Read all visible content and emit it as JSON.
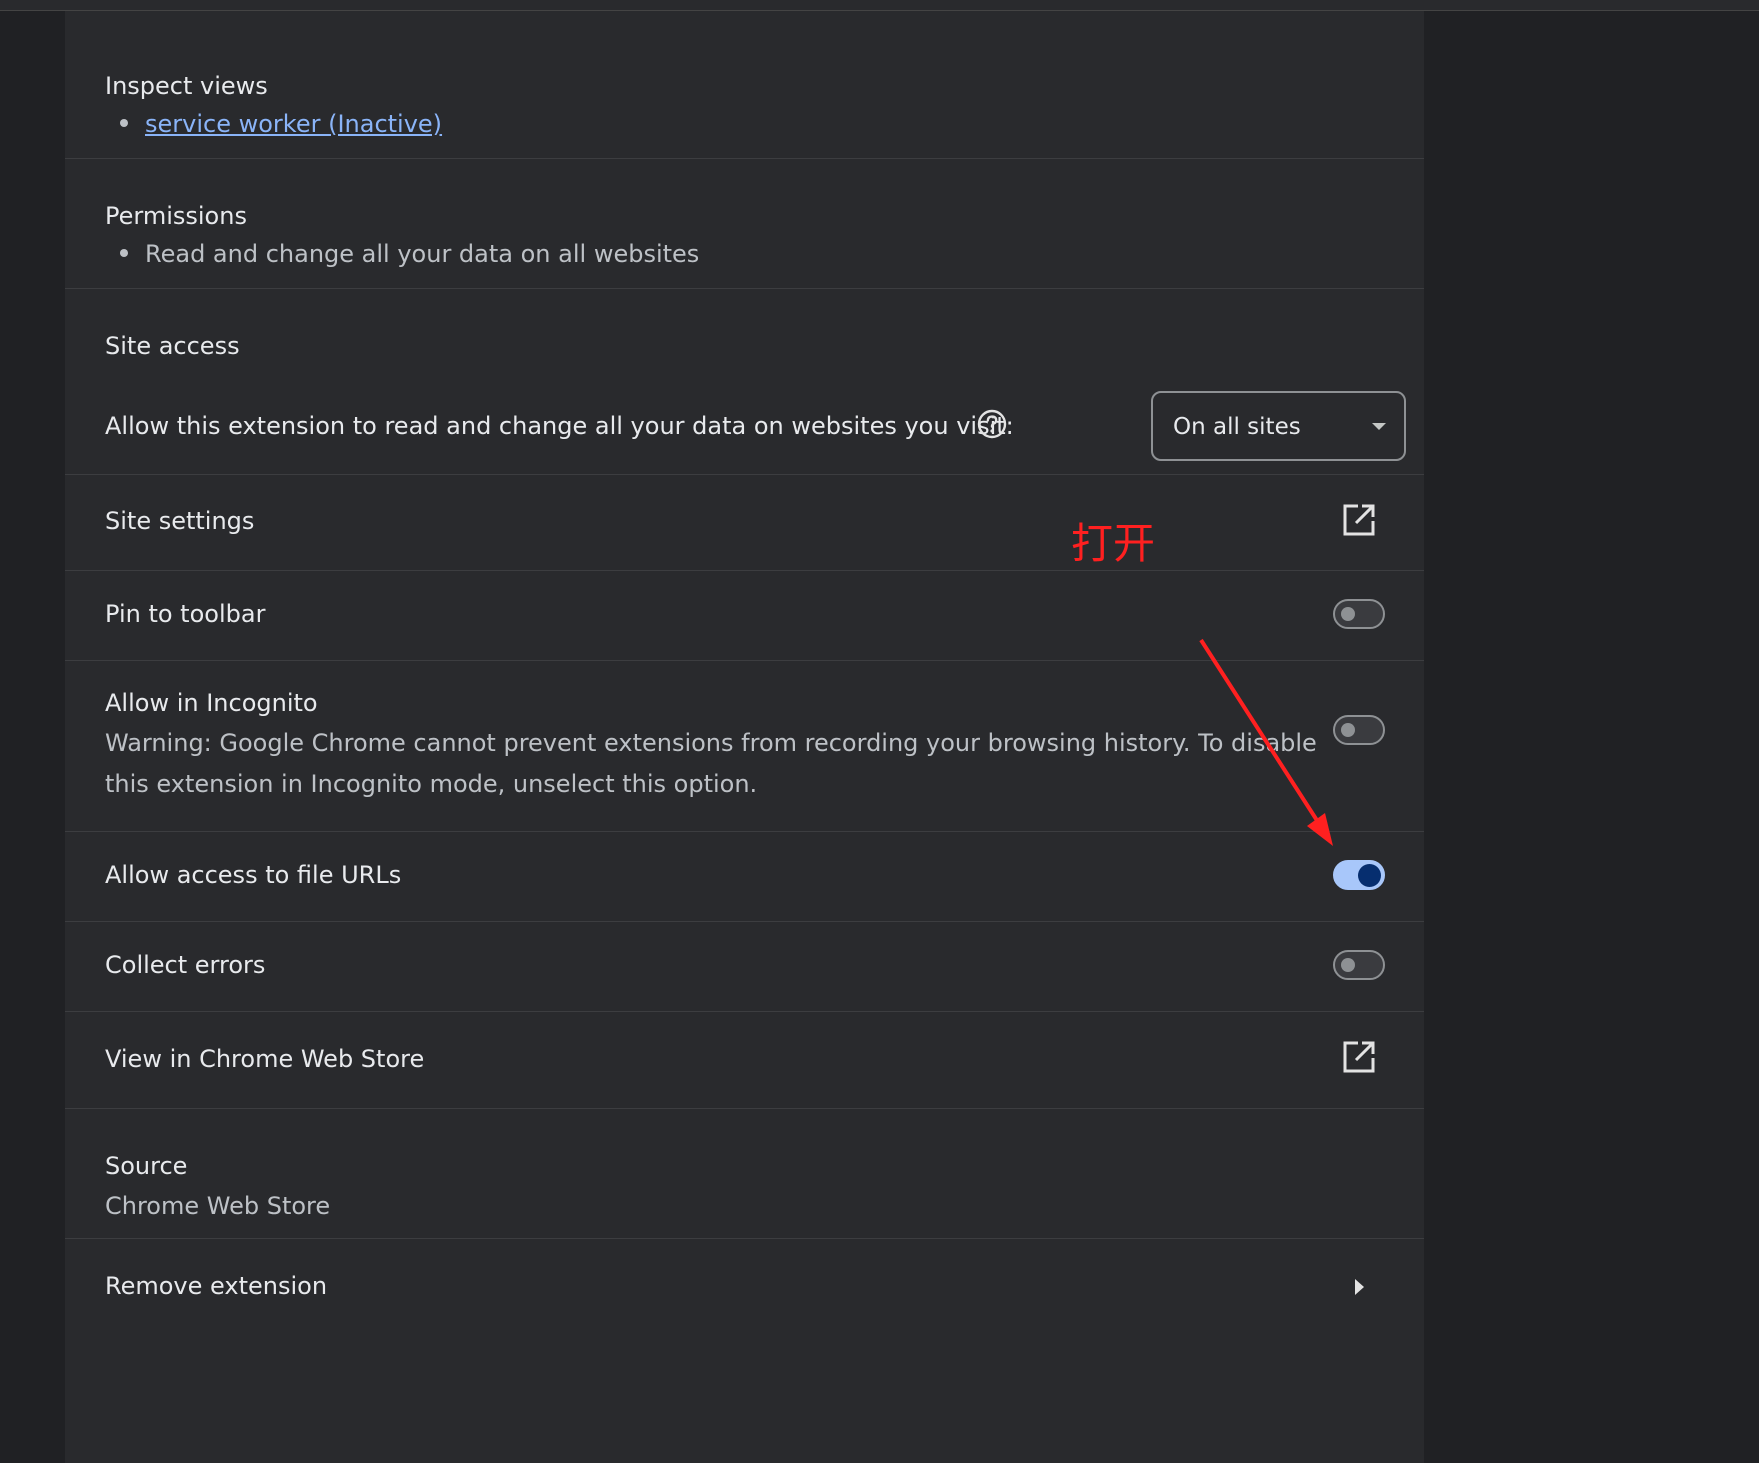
{
  "inspect_views": {
    "title": "Inspect views",
    "link": "service worker (Inactive)"
  },
  "permissions": {
    "title": "Permissions",
    "item": "Read and change all your data on all websites"
  },
  "site_access": {
    "title": "Site access",
    "description": "Allow this extension to read and change all your data on websites you visit:",
    "help_icon": "help-circle-icon",
    "dropdown_value": "On all sites"
  },
  "site_settings": {
    "label": "Site settings",
    "icon": "open-in-new-icon"
  },
  "pin_to_toolbar": {
    "label": "Pin to toolbar",
    "enabled": false
  },
  "allow_incognito": {
    "label": "Allow in Incognito",
    "warning_line1": "Warning: Google Chrome cannot prevent extensions from recording your browsing history. To disable",
    "warning_line2": "this extension in Incognito mode, unselect this option.",
    "enabled": false
  },
  "file_urls": {
    "label": "Allow access to file URLs",
    "enabled": true
  },
  "collect_errors": {
    "label": "Collect errors",
    "enabled": false
  },
  "web_store": {
    "label": "View in Chrome Web Store",
    "icon": "open-in-new-icon"
  },
  "source": {
    "title": "Source",
    "value": "Chrome Web Store"
  },
  "remove": {
    "label": "Remove extension",
    "icon": "chevron-right-icon"
  },
  "annotation": {
    "text": "打开",
    "color": "#ff2020"
  },
  "colors": {
    "background": "#202124",
    "panel": "#292a2d",
    "link": "#8ab4f8",
    "toggle_on": "#a8c7fa"
  }
}
